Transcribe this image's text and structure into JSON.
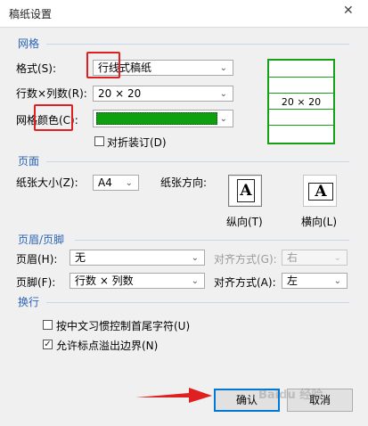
{
  "window": {
    "title": "稿纸设置",
    "close_glyph": "✕"
  },
  "grid_section": {
    "label": "网格",
    "style_label": "格式(S):",
    "style_value": "行线式稿纸",
    "rows_cols_label": "行数×列数(R):",
    "rows_cols_value": "20 × 20",
    "color_label": "网格颜色(C):",
    "color_value": "#0fa00f",
    "fold_label": "对折装订(D)",
    "fold_checked": false
  },
  "preview": {
    "text": "20 × 20",
    "color": "#15a015"
  },
  "page_section": {
    "label": "页面",
    "paper_size_label": "纸张大小(Z):",
    "paper_size_value": "A4",
    "orientation_label": "纸张方向:",
    "portrait_label": "纵向(T)",
    "landscape_label": "横向(L)",
    "icon_letter": "A",
    "selected": "portrait"
  },
  "header_footer_section": {
    "label": "页眉/页脚",
    "header_label": "页眉(H):",
    "header_value": "无",
    "header_align_label": "对齐方式(G):",
    "header_align_value": "右",
    "footer_label": "页脚(F):",
    "footer_value": "行数 × 列数",
    "footer_align_label": "对齐方式(A):",
    "footer_align_value": "左"
  },
  "wrap_section": {
    "label": "换行",
    "option1_label": "按中文习惯控制首尾字符(U)",
    "option1_checked": false,
    "option2_label": "允许标点溢出边界(N)",
    "option2_checked": true
  },
  "buttons": {
    "ok": "确认",
    "cancel": "取消"
  },
  "watermark": "Baidu 经验",
  "check_glyph": "✓",
  "arrow_glyph": "⌄",
  "colors": {
    "accent_blue": "#2b63b7",
    "annotation_red": "#e02020",
    "grid_green": "#15a015"
  }
}
